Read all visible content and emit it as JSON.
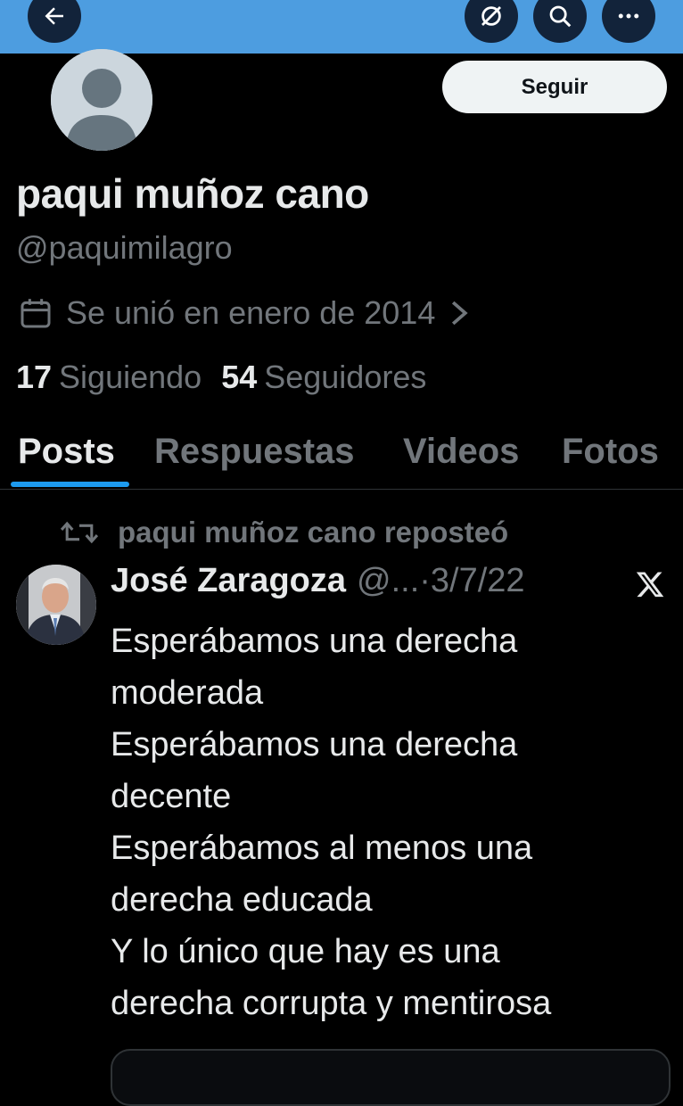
{
  "header": {
    "back_icon": "arrow-left-icon",
    "grok_icon": "grok-icon",
    "search_icon": "search-icon",
    "more_icon": "more-icon",
    "bar_color": "#4d9de0"
  },
  "profile": {
    "name": "paqui muñoz cano",
    "handle": "@paquimilagro",
    "joined": "Se unió en enero de 2014",
    "following_count": "17",
    "following_label": "Siguiendo",
    "followers_count": "54",
    "followers_label": "Seguidores",
    "follow_label": "Seguir"
  },
  "tabs": [
    {
      "label": "Posts",
      "active": true
    },
    {
      "label": "Respuestas",
      "active": false
    },
    {
      "label": "Videos",
      "active": false
    },
    {
      "label": "Fotos",
      "active": false
    }
  ],
  "post": {
    "repost_text": "paqui muñoz cano reposteó",
    "author": "José Zaragoza",
    "handle": "@...",
    "date": "·3/7/22",
    "lines": [
      "Esperábamos una derecha",
      "moderada",
      "Esperábamos una derecha",
      "decente",
      "Esperábamos al menos una",
      "derecha educada",
      "Y lo único que hay es una",
      "derecha corrupta y mentirosa"
    ]
  },
  "colors": {
    "accent": "#1d9bf0",
    "muted": "#71767b",
    "text": "#e7e9ea",
    "background": "#000000"
  }
}
